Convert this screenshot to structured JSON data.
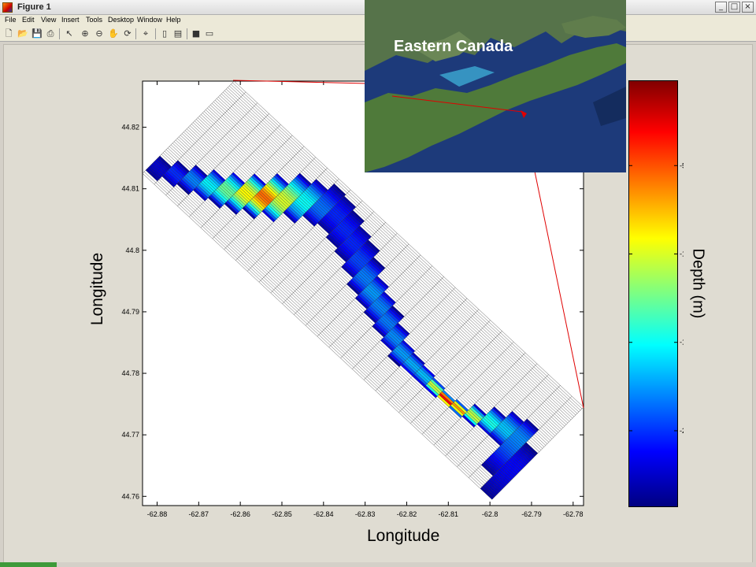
{
  "window": {
    "title": "Figure 1"
  },
  "menu": [
    "File",
    "Edit",
    "View",
    "Insert",
    "Tools",
    "Desktop",
    "Window",
    "Help"
  ],
  "toolbar_icons": [
    "new-figure-icon",
    "open-file-icon",
    "save-icon",
    "print-icon",
    "edit-plot-arrow-icon",
    "zoom-in-icon",
    "zoom-out-icon",
    "pan-hand-icon",
    "rotate-3d-icon",
    "data-cursor-icon",
    "insert-colorbar-icon",
    "insert-legend-icon",
    "hide-plot-tools-icon",
    "show-plot-tools-icon"
  ],
  "inset": {
    "label": "Eastern Canada"
  },
  "colors": {
    "ocean": "#1d3a7a",
    "land": "#4f7a3a",
    "grid_line": "#444444",
    "figure_bg": "#dfdcd2"
  },
  "chart_data": {
    "type": "heatmap",
    "xlabel": "Longitude",
    "ylabel": "Longitude",
    "x_ticks": [
      "-62.88",
      "-62.87",
      "-62.86",
      "-62.85",
      "-62.84",
      "-62.83",
      "-62.82",
      "-62.81",
      "-62.8",
      "-62.79",
      "-62.78"
    ],
    "y_ticks": [
      "44.82",
      "44.81",
      "44.8",
      "44.79",
      "44.78",
      "44.77",
      "44.76"
    ],
    "xlim": [
      -62.8835,
      -62.7775
    ],
    "ylim": [
      44.7585,
      44.8275
    ],
    "colorbar": {
      "label": "Depth (m)",
      "colormap": "jet",
      "range": [
        -24.3,
        -0.2
      ],
      "ticks": [
        "-5",
        "-10",
        "-15",
        "-20"
      ],
      "tick_values": [
        -5,
        -10,
        -15,
        -20
      ]
    },
    "grid_domain_corners": [
      [
        -62.8615,
        44.8275
      ],
      [
        -62.7775,
        44.7745
      ],
      [
        -62.7995,
        44.7585
      ],
      [
        -62.8835,
        44.8125
      ]
    ],
    "channel_path": [
      {
        "lon": -62.881,
        "lat": 44.8135,
        "depth": -1.5
      },
      {
        "lon": -62.872,
        "lat": 44.8115,
        "depth": -6
      },
      {
        "lon": -62.863,
        "lat": 44.8095,
        "depth": -12
      },
      {
        "lon": -62.854,
        "lat": 44.8085,
        "depth": -19
      },
      {
        "lon": -62.846,
        "lat": 44.8085,
        "depth": -11
      },
      {
        "lon": -62.838,
        "lat": 44.807,
        "depth": -4
      },
      {
        "lon": -62.832,
        "lat": 44.8,
        "depth": -4
      },
      {
        "lon": -62.829,
        "lat": 44.794,
        "depth": -7
      },
      {
        "lon": -62.825,
        "lat": 44.789,
        "depth": -6
      },
      {
        "lon": -62.821,
        "lat": 44.783,
        "depth": -7
      },
      {
        "lon": -62.815,
        "lat": 44.779,
        "depth": -8
      },
      {
        "lon": -62.811,
        "lat": 44.776,
        "depth": -22
      },
      {
        "lon": -62.806,
        "lat": 44.7735,
        "depth": -16
      },
      {
        "lon": -62.799,
        "lat": 44.772,
        "depth": -9
      },
      {
        "lon": -62.794,
        "lat": 44.77,
        "depth": -7
      },
      {
        "lon": -62.797,
        "lat": 44.764,
        "depth": -3
      },
      {
        "lon": -62.8,
        "lat": 44.76,
        "depth": -1
      }
    ]
  }
}
